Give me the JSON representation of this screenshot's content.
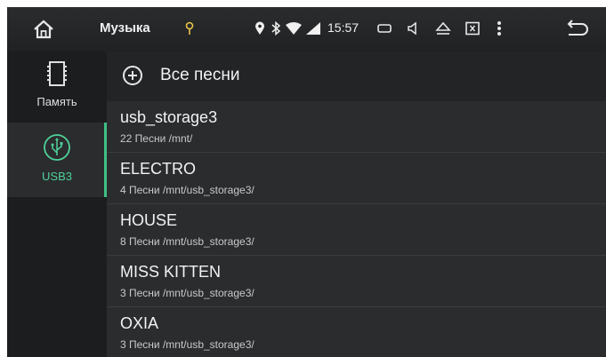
{
  "status_bar": {
    "title": "Музыка",
    "time": "15:57"
  },
  "sidebar": {
    "items": [
      {
        "label": "Память",
        "icon": "sd-card-icon",
        "selected": false
      },
      {
        "label": "USB3",
        "icon": "usb-icon",
        "selected": true
      }
    ]
  },
  "main": {
    "all_songs_label": "Все песни",
    "folders": [
      {
        "name": "usb_storage3",
        "meta": "22 Песни /mnt/"
      },
      {
        "name": "ELECTRO",
        "meta": "4 Песни /mnt/usb_storage3/"
      },
      {
        "name": "HOUSE",
        "meta": "8 Песни /mnt/usb_storage3/"
      },
      {
        "name": "MISS KITTEN",
        "meta": "3 Песни /mnt/usb_storage3/"
      },
      {
        "name": "OXIA",
        "meta": "3 Песни /mnt/usb_storage3/"
      }
    ]
  },
  "colors": {
    "accent": "#3fbf86",
    "background": "#2a2c2e",
    "sidebar": "#1b1d1f"
  }
}
